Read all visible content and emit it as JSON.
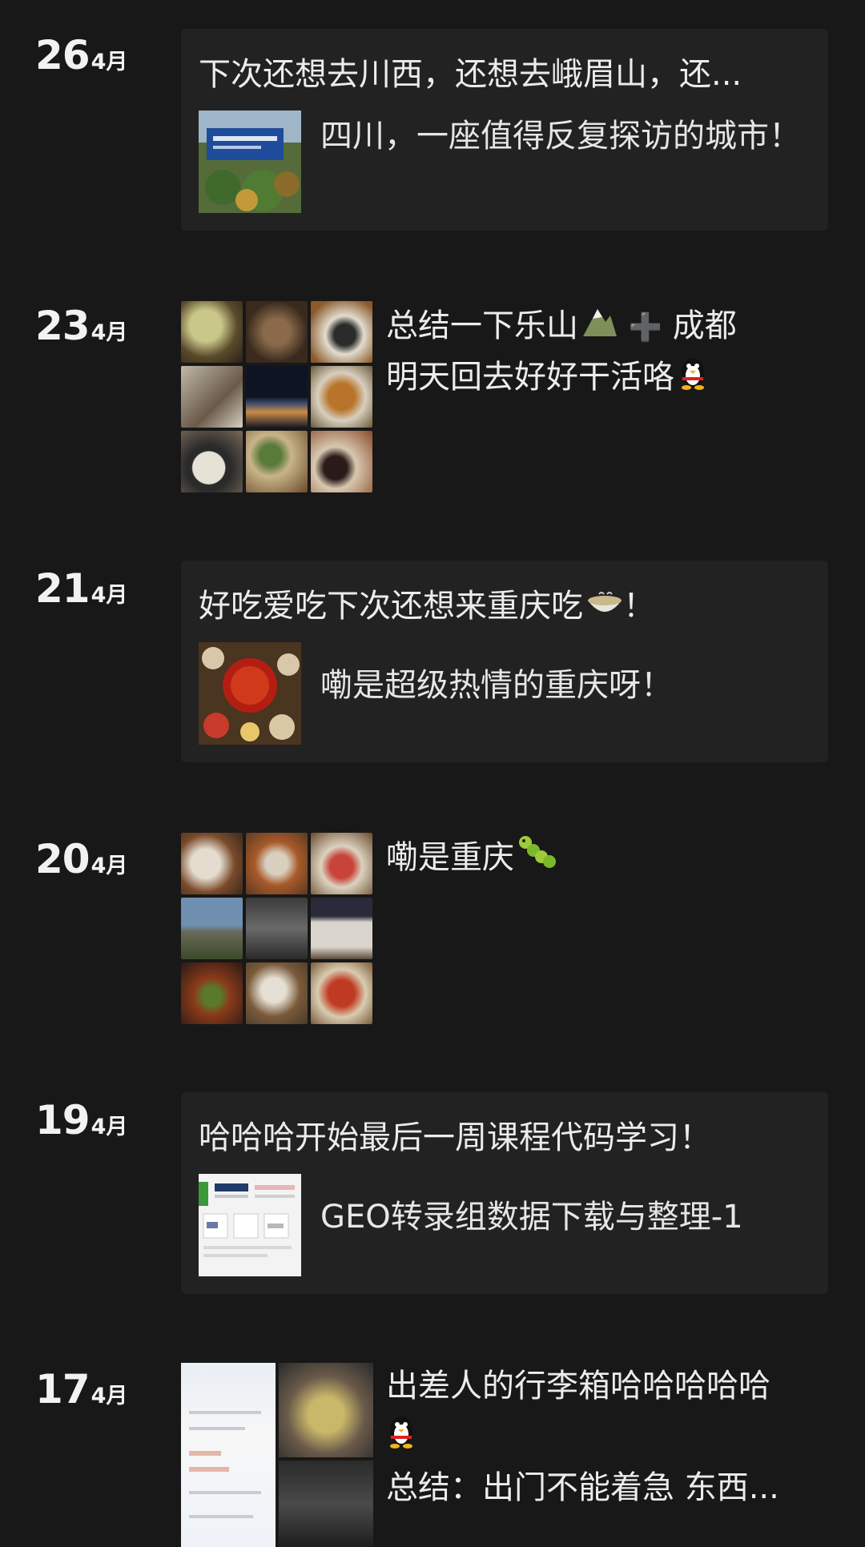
{
  "posts": [
    {
      "day": "26",
      "month": "4月",
      "title": "下次还想去川西，还想去峨眉山，还...",
      "desc": "四川，一座值得反复探访的城市！"
    },
    {
      "day": "23",
      "month": "4月",
      "text_line1": "总结一下乐山",
      "text_plus": "➕",
      "text_line1b": "成都",
      "text_line2": "明天回去好好干活咯",
      "emoji1": "mountain-icon",
      "emoji2": "penguin-icon"
    },
    {
      "day": "21",
      "month": "4月",
      "title": "好吃爱吃下次还想来重庆吃",
      "title_end": "！",
      "desc": "嘞是超级热情的重庆呀！",
      "emoji": "bowl-icon"
    },
    {
      "day": "20",
      "month": "4月",
      "text": "嘞是重庆",
      "emoji": "caterpillar-icon"
    },
    {
      "day": "19",
      "month": "4月",
      "title": "哈哈哈开始最后一周课程代码学习！",
      "desc": "GEO转录组数据下载与整理-1"
    },
    {
      "day": "17",
      "month": "4月",
      "text_line1": "出差人的行李箱哈哈哈哈哈",
      "text_line3": "总结：出门不能着急 东西...",
      "emoji": "penguin-icon"
    }
  ]
}
